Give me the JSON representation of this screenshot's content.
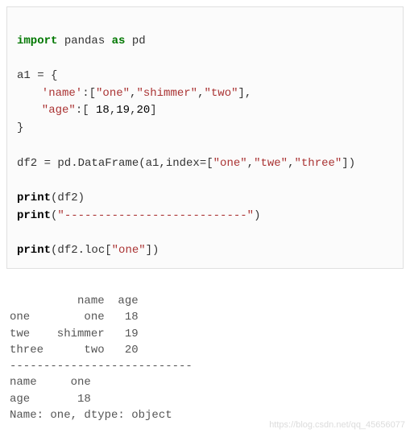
{
  "code": {
    "import_kw": "import",
    "import_mod": " pandas ",
    "as_kw": "as",
    "import_alias": " pd",
    "assign_a1": "a1 = {",
    "name_key": "'name'",
    "colon_open": ":[",
    "name_v1": "\"one\"",
    "comma": ",",
    "name_v2": "\"shimmer\"",
    "name_v3": "\"two\"",
    "close_list_comma": "],",
    "age_key": "\"age\"",
    "age_open": ":[ ",
    "age_v1": "18",
    "age_v2": "19",
    "age_v3": "20",
    "close_list": "]",
    "close_brace": "}",
    "df2_assign_pre": "df2 = pd.DataFrame(a1,index=[",
    "idx_v1": "\"one\"",
    "idx_v2": "\"twe\"",
    "idx_v3": "\"three\"",
    "df2_assign_post": "])",
    "print_kw": "print",
    "print_df2_arg": "(df2)",
    "print_sep_open": "(",
    "sep_string": "\"---------------------------\"",
    "print_sep_close": ")",
    "print_loc_open": "(df2.loc[",
    "loc_key": "\"one\"",
    "print_loc_close": "])"
  },
  "output": {
    "line1": "          name  age",
    "line2": "one        one   18",
    "line3": "twe    shimmer   19",
    "line4": "three      two   20",
    "line5": "---------------------------",
    "line6": "name     one",
    "line7": "age       18",
    "line8": "Name: one, dtype: object"
  },
  "watermark": "https://blog.csdn.net/qq_45656077"
}
